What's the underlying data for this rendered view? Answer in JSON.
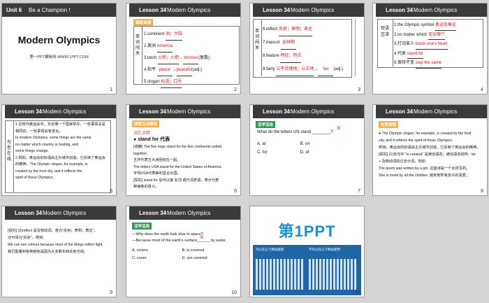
{
  "slides": [
    {
      "num": "1",
      "unit": "Unit 6",
      "unit_title": "Be a Champion !",
      "title": "Modern Olympics",
      "credit": "第一PPT模板网-WWW.1PPT.COM"
    },
    {
      "num": "2",
      "lesson": "Lesson 34",
      "title": "Modern Olympics",
      "tag": "课前自测",
      "vertical": [
        "单",
        "词",
        "闯",
        "关"
      ],
      "items": [
        {
          "pre": "1.continent ",
          "ans": "洲；大陆",
          "post": ""
        },
        {
          "pre": "2.美洲 ",
          "ans": "America",
          "post": ""
        },
        {
          "pre": "3.torch ",
          "ans": "火炬；火把",
          "mid": "→",
          "ans2": "torches",
          "post": "(复数)"
        },
        {
          "pre": "4.和平 ",
          "ans": "peace",
          "mid": "→",
          "ans2": "peaceful",
          "post": "(adj.)"
        },
        {
          "pre": "5.slogan ",
          "ans": "标语；口号",
          "post": ""
        }
      ]
    },
    {
      "num": "3",
      "lesson": "Lesson 34",
      "title": "Modern Olympics",
      "vertical": [
        "单",
        "词",
        "闯",
        "关"
      ],
      "items": [
        {
          "pre": "6.reflect ",
          "ans": "反射；表明；表达",
          "post": ""
        },
        {
          "pre": "7.mascot ",
          "ans": "吉祥物",
          "post": ""
        },
        {
          "pre": "8.feature ",
          "ans": "特征；特点",
          "post": ""
        },
        {
          "pre": "9.fairly ",
          "ans": "公平合理地；公正地",
          "mid": "→",
          "ans2": "fair",
          "post": "(adj.)"
        }
      ]
    },
    {
      "num": "4",
      "lesson": "Lesson 34",
      "title": "Modern Olympics",
      "vertical": [
        "短",
        "语",
        "互",
        "译"
      ],
      "items": [
        {
          "pre": "1.the Olympic symbol ",
          "ans": "奥运会象征"
        },
        {
          "pre": "2.no matter which ",
          "ans": "无论哪个"
        },
        {
          "pre": "3.打动某人 ",
          "ans": "touch one's heart"
        },
        {
          "pre": "4.代表 ",
          "ans": "stand for"
        },
        {
          "pre": "5.保持不变 ",
          "ans": "stay the same"
        }
      ]
    },
    {
      "num": "5",
      "lesson": "Lesson 34",
      "title": "Modern Olympics",
      "vertical": [
        "句",
        "型",
        "在",
        "线"
      ],
      "lines": [
        "1.在现代奥运会中，无论哪一个国家举办，一些事情总是相同的，一些事情会有变化。",
        "In modern Olympics, some things are the same",
        "no matter which country is hosting, and",
        "some things change.",
        "2.例如，奥运会的标语由主办城市创造，它反映了奥运会的精神。The Olympic slogan, for example, is",
        "created by the host city, and it reflects the",
        "spirit of those Olympics."
      ],
      "blanks": [
        "matter",
        "which",
        "is created",
        "by"
      ]
    },
    {
      "num": "6",
      "lesson": "Lesson 34",
      "title": "Modern Olympics",
      "tag": "课堂互动探究",
      "sub": "词汇点睛",
      "head": "stand for 代表",
      "lines": [
        "[观察] The five rings stand for the five continents united",
        "together.",
        "五环代表五大洲团结在一起。",
        "The letters USA stand for the United States of America.",
        "字母USA代表美利坚合众国。",
        "[探究] stand for 后可以接 名词 或代词宾语，表示代表",
        "种抽象的意义。"
      ],
      "blank": "名词"
    },
    {
      "num": "7",
      "lesson": "Lesson 34",
      "title": "Modern Olympics",
      "tag": "活学活用",
      "question": "What do the letters UN stand ________?",
      "answer": "B",
      "options": [
        "A. at",
        "B. on",
        "C. for",
        "D. of"
      ]
    },
    {
      "num": "8",
      "lesson": "Lesson 34",
      "title": "Modern Olympics",
      "tag": "句型透视",
      "lines": [
        "● The Olympic slogan, for example, is created by the host",
        "city, and it reflects the spirit of those Olympics.",
        "例如，奥运会的标语由主办城市创造，它反映了奥运会的精神。",
        "[探究] (1)本句中 \"is created\" 是被动语态，被动语态结构：be",
        "+ 及物动词的过去分词，例如：",
        "The poem was written by a girl. 这首诗是一个女孩写的。",
        "She is loved by all the children. 她受到所有孩子的喜爱。"
      ]
    },
    {
      "num": "9",
      "lesson": "Lesson 34",
      "title": "Modern Olympics",
      "lines": [
        "[探究] (2)reflect 是及物动词，意为\"反射；表明；表达\"，",
        "还可译为\"反射\"，例如：",
        "We can see colours because most of the things reflect light.",
        "我们能看到各种颜色是因为大多数东西反射光线。"
      ]
    },
    {
      "num": "10",
      "lesson": "Lesson 34",
      "title": "Modern Olympics",
      "tag": "活学活用",
      "q1": "—Why does the earth look blue in space?",
      "q2": "—Because most of the earth's surface______ by water.",
      "answer": "B",
      "options": [
        "A. covers",
        "B. is covered",
        "C. cover",
        "D. are covered"
      ]
    },
    {
      "num": "11",
      "logo_text": "第1PPT",
      "ad_left": "可以在以下网站搜索",
      "ad_right": "不可以在以下网站使用"
    }
  ],
  "colors": {
    "header": "#3a3a3a",
    "answer_red": "#dd1111",
    "tag_orange": "#f3b24a",
    "tag_green": "#2d9a5a",
    "logo_blue": "#1a8fd6"
  }
}
